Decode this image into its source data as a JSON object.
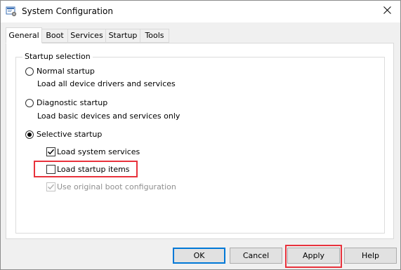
{
  "window": {
    "title": "System Configuration",
    "icon": "msconfig-app-icon",
    "close_icon": "close-icon"
  },
  "tabs": [
    {
      "label": "General",
      "active": true
    },
    {
      "label": "Boot",
      "active": false
    },
    {
      "label": "Services",
      "active": false
    },
    {
      "label": "Startup",
      "active": false
    },
    {
      "label": "Tools",
      "active": false
    }
  ],
  "general": {
    "group_title": "Startup selection",
    "normal": {
      "label": "Normal startup",
      "description": "Load all device drivers and services",
      "selected": false
    },
    "diagnostic": {
      "label": "Diagnostic startup",
      "description": "Load basic devices and services only",
      "selected": false
    },
    "selective": {
      "label": "Selective startup",
      "selected": true
    },
    "options": {
      "load_system_services": {
        "label": "Load system services",
        "checked": true,
        "enabled": true
      },
      "load_startup_items": {
        "label": "Load startup items",
        "checked": false,
        "enabled": true,
        "highlighted": true
      },
      "use_original_boot": {
        "label": "Use original boot configuration",
        "checked": true,
        "enabled": false
      }
    }
  },
  "buttons": {
    "ok": "OK",
    "cancel": "Cancel",
    "apply": "Apply",
    "help": "Help",
    "apply_highlighted": true
  },
  "colors": {
    "highlight": "#e8323c",
    "focus_border": "#0078d7",
    "window_bg": "#f0f0f0",
    "panel_bg": "#ffffff"
  }
}
